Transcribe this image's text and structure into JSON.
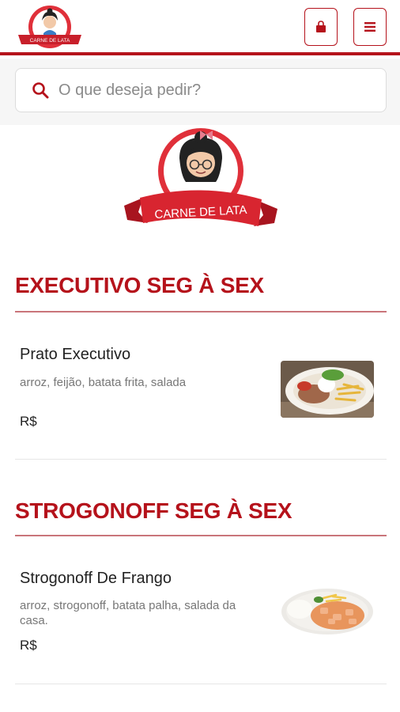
{
  "header": {
    "brand_text": "CARNE DE LATA",
    "cart_icon": "shopping-bag-icon",
    "menu_icon": "hamburger-menu-icon"
  },
  "search": {
    "placeholder": "O que deseja pedir?",
    "icon": "search-icon"
  },
  "colors": {
    "brand_red": "#b5121b",
    "divider": "#c9757a",
    "muted_text": "#777777"
  },
  "sections": [
    {
      "title": "EXECUTIVO SEG À SEX",
      "items": [
        {
          "name": "Prato Executivo",
          "description": "arroz, feijão, batata frita, salada",
          "price": "R$"
        }
      ]
    },
    {
      "title": "STROGONOFF SEG À SEX",
      "items": [
        {
          "name": "Strogonoff De Frango",
          "description": "arroz, strogonoff, batata palha, salada da casa.",
          "price": "R$"
        }
      ]
    }
  ]
}
